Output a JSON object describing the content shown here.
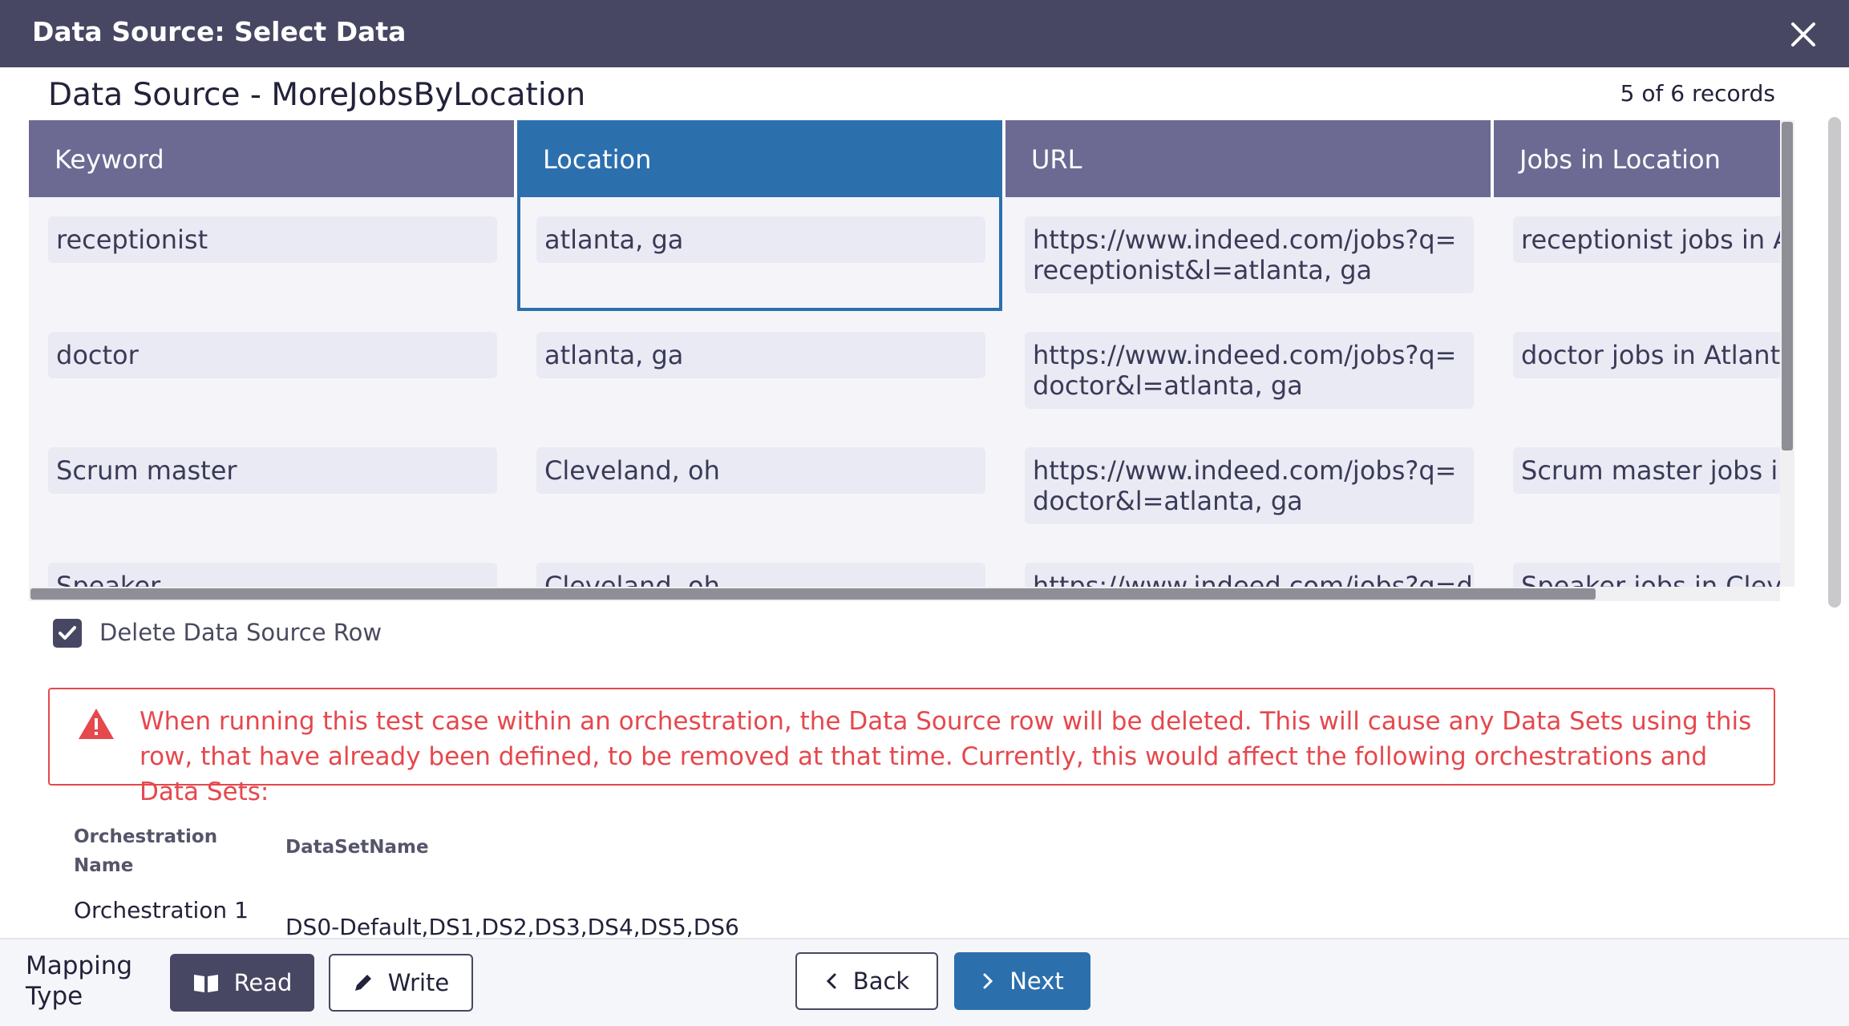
{
  "dialog": {
    "title": "Data Source: Select Data",
    "close_icon": "close-icon"
  },
  "data_source": {
    "name": "Data Source - MoreJobsByLocation",
    "records": "5 of 6 records"
  },
  "grid": {
    "columns": [
      "Keyword",
      "Location",
      "URL",
      "Jobs in Location"
    ],
    "selected_column": "Location",
    "rows": [
      [
        "receptionist",
        "atlanta, ga",
        "https://www.indeed.com/jobs?q=receptionist&l=atlanta, ga",
        "receptionist jobs in Atlanta, ga"
      ],
      [
        "doctor",
        "atlanta, ga",
        "https://www.indeed.com/jobs?q=doctor&l=atlanta, ga",
        "doctor jobs in Atlanta, ga"
      ],
      [
        "Scrum master",
        "Cleveland, oh",
        "https://www.indeed.com/jobs?q=doctor&l=atlanta, ga",
        "Scrum master jobs in Cleveland, oh"
      ],
      [
        "Speaker",
        "Cleveland, oh",
        "https://www.indeed.com/jobs?q=d",
        "Speaker jobs in Cleveland"
      ]
    ]
  },
  "delete_row": {
    "label": "Delete Data Source Row",
    "checked": true
  },
  "warning": {
    "icon": "warning-icon",
    "text": "When running this test case within an orchestration, the Data Source row will be deleted. This will cause any Data Sets using this row, that have already been defined, to be removed at that time. Currently, this would affect the following orchestrations and Data Sets:"
  },
  "orchestrations": {
    "headers": [
      "Orchestration Name",
      "DataSetName"
    ],
    "rows": [
      [
        "Orchestration 1",
        "DS0-Default,DS1,DS2,DS3,DS4,DS5,DS6"
      ]
    ]
  },
  "footer": {
    "mapping_type_label": "Mapping Type",
    "read_label": "Read",
    "write_label": "Write",
    "back_label": "Back",
    "next_label": "Next"
  },
  "colors": {
    "titlebar": "#474763",
    "column_header": "#6c6a93",
    "selected_column": "#2c6fad",
    "warning": "#e5484d",
    "primary_button": "#2c6fad"
  }
}
